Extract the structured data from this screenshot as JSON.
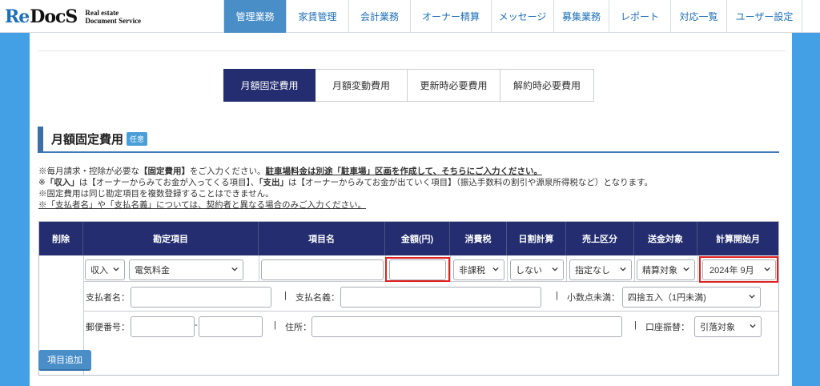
{
  "logo": {
    "mark_re": "Re",
    "mark_docs": "DocS",
    "sub_line1": "Real estate",
    "sub_line2": "Document Service"
  },
  "nav": [
    {
      "label": "管理業務",
      "active": true
    },
    {
      "label": "家賃管理"
    },
    {
      "label": "会計業務"
    },
    {
      "label": "オーナー精算"
    },
    {
      "label": "メッセージ"
    },
    {
      "label": "募集業務"
    },
    {
      "label": "レポート"
    },
    {
      "label": "対応一覧"
    },
    {
      "label": "ユーザー設定"
    }
  ],
  "tabs": [
    {
      "label": "月額固定費用",
      "active": true
    },
    {
      "label": "月額変動費用"
    },
    {
      "label": "更新時必要費用"
    },
    {
      "label": "解約時必要費用"
    }
  ],
  "section": {
    "title": "月額固定費用",
    "badge": "任意"
  },
  "notes": {
    "l1_a": "※毎月請求・控除が必要な",
    "l1_b": "【固定費用】",
    "l1_c": "をご入力ください。",
    "l1_d": "駐車場料金は別途「駐車場」区画を作成して、そちらにご入力ください。",
    "l2_a": "※",
    "l2_b": "「収入」",
    "l2_c": "は【オーナーからみてお金が入ってくる項目】、",
    "l2_d": "「支出」",
    "l2_e": "は【オーナーからみてお金が出ていく項目】（振込手数料の割引や源泉所得税など）となります。",
    "l3": "※固定費用は同じ勘定項目を複数登録することはできません。",
    "l4": "※「支払者名」や「支払名義」については、契約者と異なる場合のみご入力ください。"
  },
  "table": {
    "headers": [
      "削除",
      "勘定項目",
      "項目名",
      "金額(円)",
      "消費税",
      "日割計算",
      "売上区分",
      "送金対象",
      "計算開始月"
    ],
    "row": {
      "income_type": "収入",
      "account_item": "電気料金",
      "item_name": "",
      "amount": "",
      "tax": "非課税",
      "prorate": "しない",
      "sales_category": "指定なし",
      "remit_target": "精算対象",
      "start_month": "2024年 9月"
    },
    "sub1": {
      "payer_label": "支払者名：",
      "payer_value": "",
      "sep1": "|",
      "name_label": "支払名義：",
      "name_value": "",
      "sep2": "|",
      "decimal_label": "小数点未満：",
      "decimal_value": "四捨五入（1円未満)"
    },
    "sub2": {
      "zip_label": "郵便番号：",
      "zip_dash": "-",
      "sep1": "|",
      "address_label": "住所：",
      "sep2": "|",
      "transfer_label": "口座振替：",
      "transfer_value": "引落対象"
    }
  },
  "add_button": "項目追加",
  "colors": {
    "accent": "#232d6f",
    "nav_active": "#4a8ec8",
    "highlight": "#e02020",
    "background": "#44a0e4"
  }
}
